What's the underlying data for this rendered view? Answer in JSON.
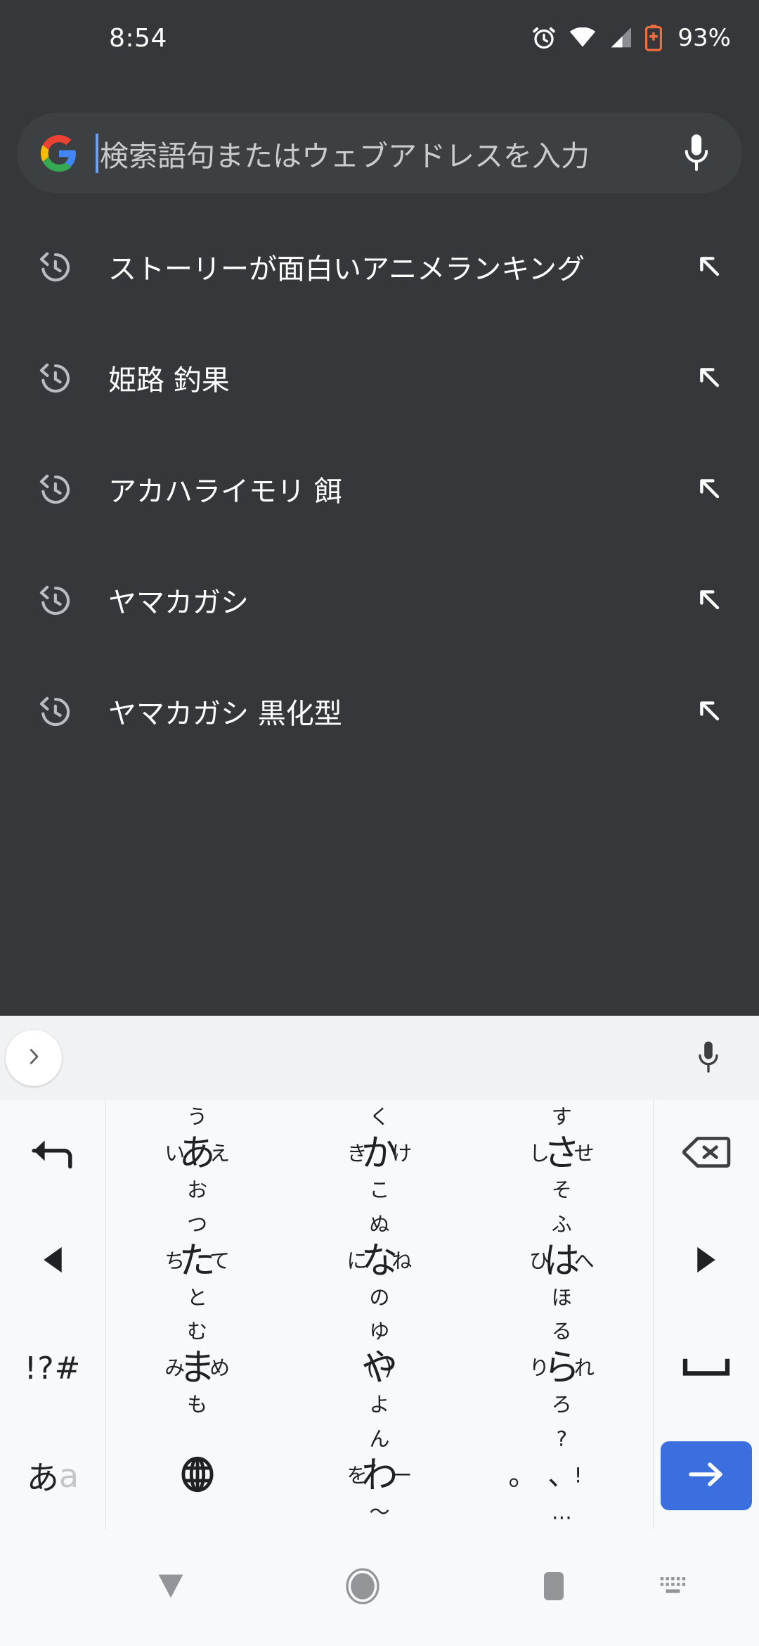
{
  "statusbar": {
    "time": "8:54",
    "battery_percent": "93%",
    "icons": [
      "alarm-icon",
      "wifi-icon",
      "cellular-signal-icon",
      "battery-saver-icon"
    ]
  },
  "searchbar": {
    "placeholder": "検索語句またはウェブアドレスを入力",
    "value": "",
    "logo": "google-g-logo",
    "mic": "microphone-icon",
    "caret_color": "#6ea0f0",
    "background": "#3d4043"
  },
  "suggestions": {
    "items": [
      {
        "text": "ストーリーが面白いアニメランキング",
        "icon": "history-clock-icon",
        "action_icon": "arrow-up-left-icon"
      },
      {
        "text": "姫路 釣果",
        "icon": "history-clock-icon",
        "action_icon": "arrow-up-left-icon"
      },
      {
        "text": "アカハライモリ 餌",
        "icon": "history-clock-icon",
        "action_icon": "arrow-up-left-icon"
      },
      {
        "text": "ヤマカガシ",
        "icon": "history-clock-icon",
        "action_icon": "arrow-up-left-icon"
      },
      {
        "text": "ヤマカガシ 黒化型",
        "icon": "history-clock-icon",
        "action_icon": "arrow-up-left-icon"
      }
    ]
  },
  "keyboard_toolbar": {
    "expand_icon": "chevron-right-icon",
    "mic_icon": "microphone-icon",
    "background": "#f0f2f4"
  },
  "keyboard": {
    "background": "#f8f9fa",
    "enter_color": "#3b6fe0",
    "rows": [
      {
        "left": {
          "name": "undo-key",
          "label": "↰",
          "icon": "undo-arrow-icon"
        },
        "keys": [
          {
            "center": "あ",
            "up": "う",
            "left": "い",
            "right": "え",
            "down": "お"
          },
          {
            "center": "か",
            "up": "く",
            "left": "き",
            "right": "け",
            "down": "こ"
          },
          {
            "center": "さ",
            "up": "す",
            "left": "し",
            "right": "せ",
            "down": "そ"
          }
        ],
        "right": {
          "name": "backspace-key",
          "icon": "backspace-icon"
        }
      },
      {
        "left": {
          "name": "cursor-left-key",
          "icon": "triangle-left-icon"
        },
        "keys": [
          {
            "center": "た",
            "up": "つ",
            "left": "ち",
            "right": "て",
            "down": "と"
          },
          {
            "center": "な",
            "up": "ぬ",
            "left": "に",
            "right": "ね",
            "down": "の"
          },
          {
            "center": "は",
            "up": "ふ",
            "left": "ひ",
            "right": "へ",
            "down": "ほ"
          }
        ],
        "right": {
          "name": "cursor-right-key",
          "icon": "triangle-right-icon"
        }
      },
      {
        "left": {
          "name": "symbols-key",
          "label": "!?#"
        },
        "keys": [
          {
            "center": "ま",
            "up": "む",
            "left": "み",
            "right": "め",
            "down": "も"
          },
          {
            "center": "や",
            "up": "ゆ",
            "left": "(",
            "right": ")",
            "down": "よ"
          },
          {
            "center": "ら",
            "up": "る",
            "left": "り",
            "right": "れ",
            "down": "ろ"
          }
        ],
        "right": {
          "name": "space-key",
          "icon": "space-bar-icon"
        }
      },
      {
        "left": {
          "name": "kana-latin-toggle-key",
          "label_kana": "あ",
          "label_latin": "a"
        },
        "keys": [
          {
            "center": "globe-icon",
            "is_icon": true
          },
          {
            "center": "わ",
            "up": "ん",
            "left": "を",
            "right": "ー",
            "down": "〜"
          },
          {
            "center": "、",
            "center2": "。",
            "up": "?",
            "right": "!",
            "down": "…"
          }
        ],
        "right": {
          "name": "enter-key",
          "icon": "arrow-right-icon"
        }
      }
    ]
  },
  "navbar": {
    "background": "#f8f9fa",
    "items": [
      {
        "name": "nav-back-hide-keyboard",
        "icon": "triangle-down-icon"
      },
      {
        "name": "nav-home",
        "icon": "circle-icon"
      },
      {
        "name": "nav-recents",
        "icon": "square-icon"
      },
      {
        "name": "nav-keyboard-switcher",
        "icon": "keyboard-switch-icon"
      }
    ]
  }
}
